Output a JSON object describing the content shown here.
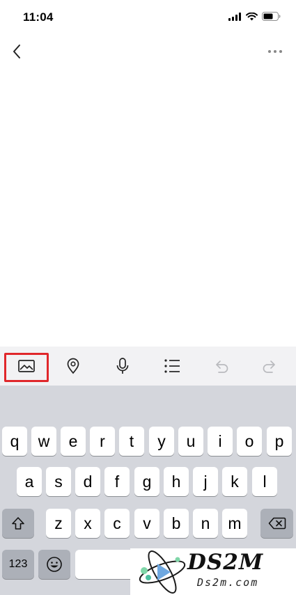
{
  "status_bar": {
    "time": "11:04",
    "icons": [
      "signal-icon",
      "wifi-icon",
      "battery-icon"
    ]
  },
  "nav_bar": {
    "back_icon": "chevron-left-icon",
    "more_icon": "more-horizontal-icon"
  },
  "toolbar": {
    "items": [
      "image-icon",
      "location-icon",
      "microphone-icon",
      "list-icon",
      "undo-icon",
      "redo-icon"
    ],
    "highlight_color": "#e0272b",
    "disabled_color": "#b9babe"
  },
  "keyboard": {
    "row1": [
      "q",
      "w",
      "e",
      "r",
      "t",
      "y",
      "u",
      "i",
      "o",
      "p"
    ],
    "row2": [
      "a",
      "s",
      "d",
      "f",
      "g",
      "h",
      "j",
      "k",
      "l"
    ],
    "row3": [
      "z",
      "x",
      "c",
      "v",
      "b",
      "n",
      "m"
    ],
    "numbers_label": "123",
    "shift_icon": "shift-icon",
    "delete_icon": "delete-icon",
    "emoji_icon": "emoji-icon"
  },
  "watermark": {
    "title": "DS2M",
    "subtitle": "Ds2m.com"
  }
}
